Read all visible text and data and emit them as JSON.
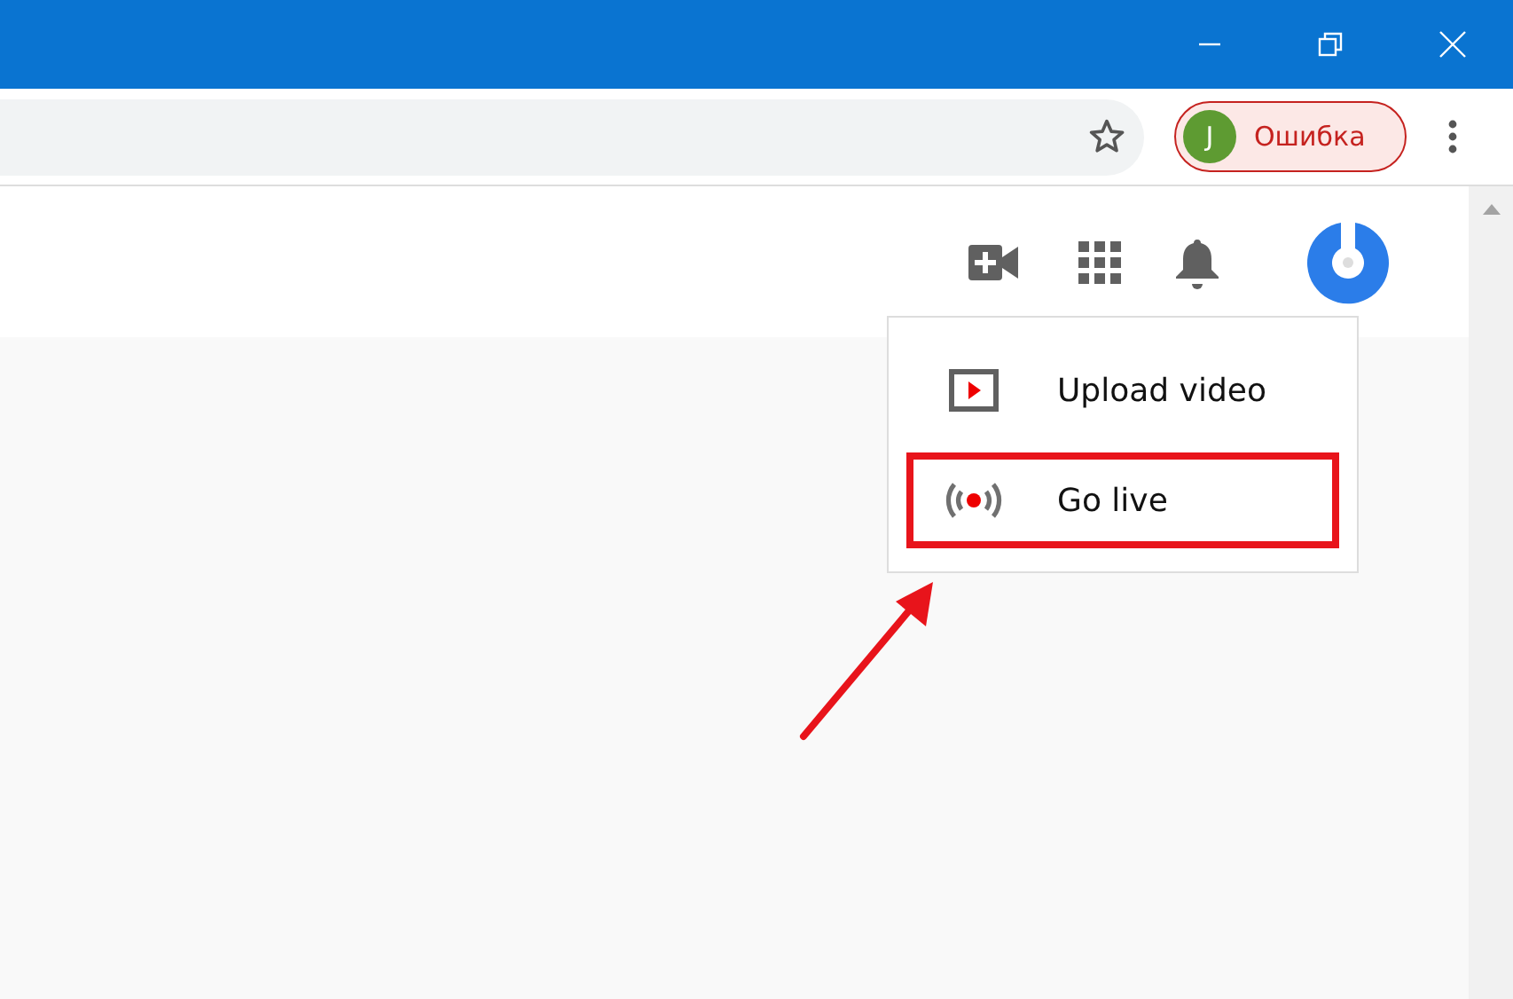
{
  "window": {
    "controls": [
      {
        "kind": "minimize"
      },
      {
        "kind": "restore"
      },
      {
        "kind": "close"
      }
    ]
  },
  "toolbar": {
    "profile": {
      "initial": "J",
      "status": "Ошибка"
    }
  },
  "header": {
    "icons": [
      {
        "kind": "create"
      },
      {
        "kind": "apps"
      },
      {
        "kind": "notifications"
      },
      {
        "kind": "avatar"
      }
    ]
  },
  "menu": {
    "items": [
      {
        "kind": "upload",
        "label": "Upload video",
        "highlighted": false
      },
      {
        "kind": "live",
        "label": "Go live",
        "highlighted": true
      }
    ]
  },
  "annotation": {
    "kind": "arrow"
  }
}
